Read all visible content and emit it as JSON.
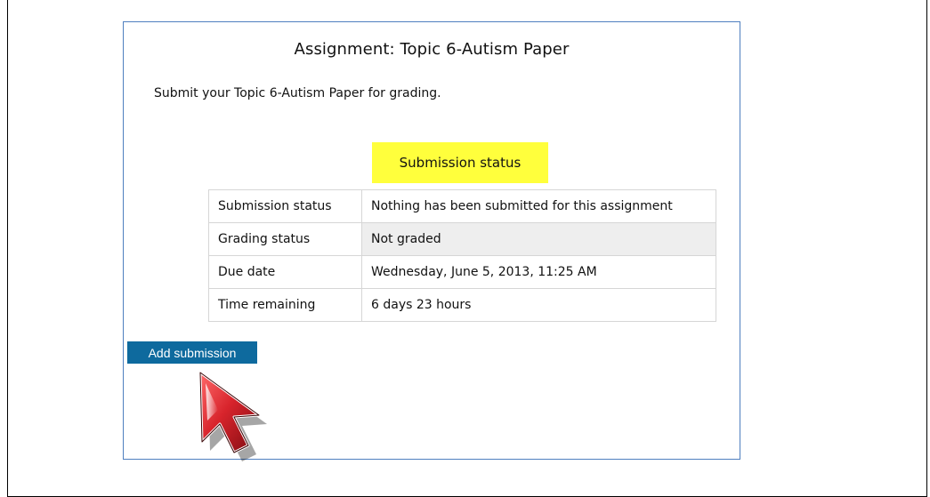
{
  "assignment": {
    "title": "Assignment: Topic 6-Autism Paper",
    "intro": "Submit your Topic 6-Autism Paper for grading."
  },
  "submission_status_section": {
    "heading": "Submission status",
    "heading_color": "#ffff3c",
    "rows": [
      {
        "label": "Submission status",
        "value": "Nothing has been submitted for this assignment",
        "shaded": false
      },
      {
        "label": "Grading status",
        "value": "Not graded",
        "shaded": true
      },
      {
        "label": "Due date",
        "value": "Wednesday, June 5, 2013, 11:25 AM",
        "shaded": false
      },
      {
        "label": "Time remaining",
        "value": "6 days 23 hours",
        "shaded": false
      }
    ]
  },
  "actions": {
    "add_submission_label": "Add submission",
    "button_color": "#0e6a9e"
  },
  "cursor": {
    "icon": "mouse-pointer-arrow-icon",
    "color": "#c8202a"
  }
}
